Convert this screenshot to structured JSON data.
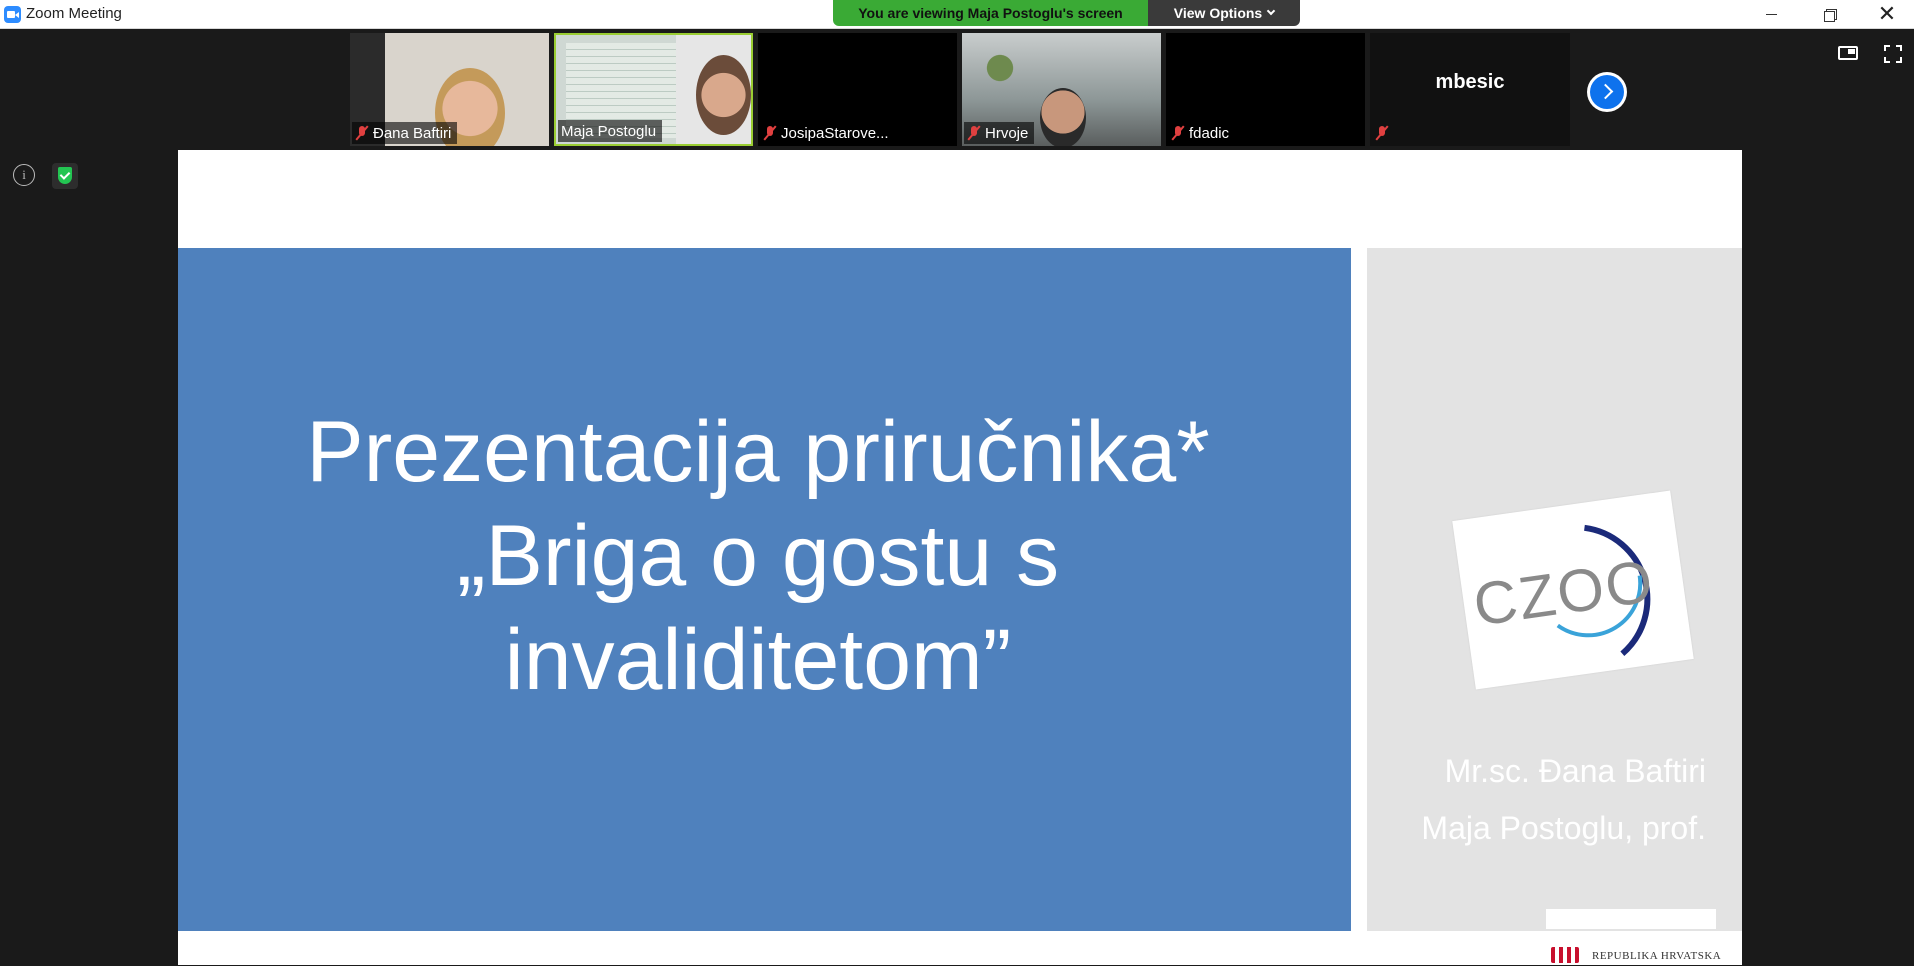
{
  "window": {
    "title": "Zoom Meeting"
  },
  "banner": {
    "text": "You are viewing Maja Postoglu's screen",
    "view_options": "View Options"
  },
  "participants": [
    {
      "name": "Đana Baftiri",
      "muted": true
    },
    {
      "name": "Maja Postoglu",
      "muted": false
    },
    {
      "name": "JosipaStarove...",
      "muted": true
    },
    {
      "name": "Hrvoje",
      "muted": true
    },
    {
      "name": "fdadic",
      "muted": true
    },
    {
      "name": "mbesic",
      "muted": true
    }
  ],
  "slide": {
    "title_lines": [
      "Prezentacija priručnika*",
      "„Briga o gostu s",
      "invaliditetom”"
    ],
    "author1": "Mr.sc. Đana Baftiri",
    "author2": "Maja Postoglu, prof.",
    "logo_text": "CZOO",
    "gov_text": "REPUBLIKA HRVATSKA"
  },
  "colors": {
    "slide_blue": "#4f81bd",
    "banner_green": "#3aaa35",
    "accent_blue": "#0e72ed"
  }
}
